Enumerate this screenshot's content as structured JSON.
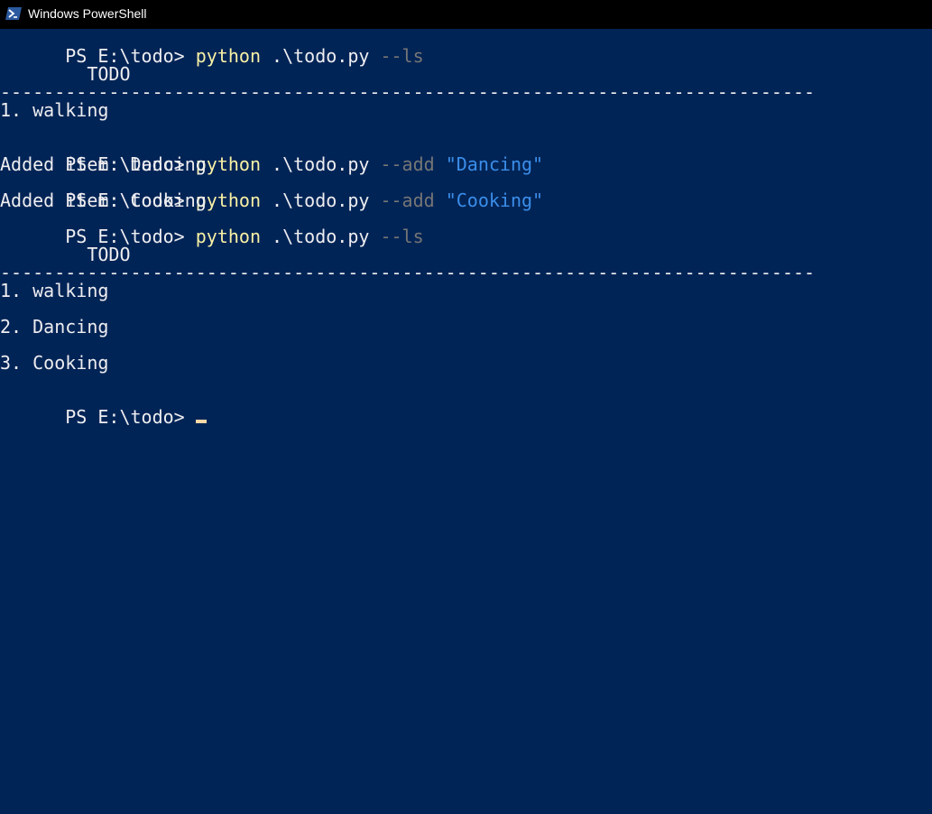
{
  "window": {
    "title": "Windows PowerShell",
    "icon": "powershell-icon"
  },
  "colors": {
    "background": "#012456",
    "titlebar": "#000000",
    "text": "#eeedf0",
    "command": "#f9f1a5",
    "flag": "#767676",
    "string": "#3b8eea",
    "cursor": "#fed7a5"
  },
  "console": {
    "prompt": "PS E:\\todo> ",
    "lines": {
      "l1": {
        "cmd": "python",
        "arg": " .\\todo.py ",
        "flag": "--ls"
      },
      "l3": "        TODO",
      "l4": "---------------------------------------------------------------------------",
      "l5": "1. walking",
      "l7": {
        "cmd": "python",
        "arg": " .\\todo.py ",
        "flag": "--add ",
        "str": "\"Dancing\""
      },
      "l8": "Added item: Dancing",
      "l9": {
        "cmd": "python",
        "arg": " .\\todo.py ",
        "flag": "--add ",
        "str": "\"Cooking\""
      },
      "l10": "Added item: Cooking",
      "l11": {
        "cmd": "python",
        "arg": " .\\todo.py ",
        "flag": "--ls"
      },
      "l13": "        TODO",
      "l14": "---------------------------------------------------------------------------",
      "l15": "1. walking",
      "l17": "2. Dancing",
      "l19": "3. Cooking"
    }
  }
}
